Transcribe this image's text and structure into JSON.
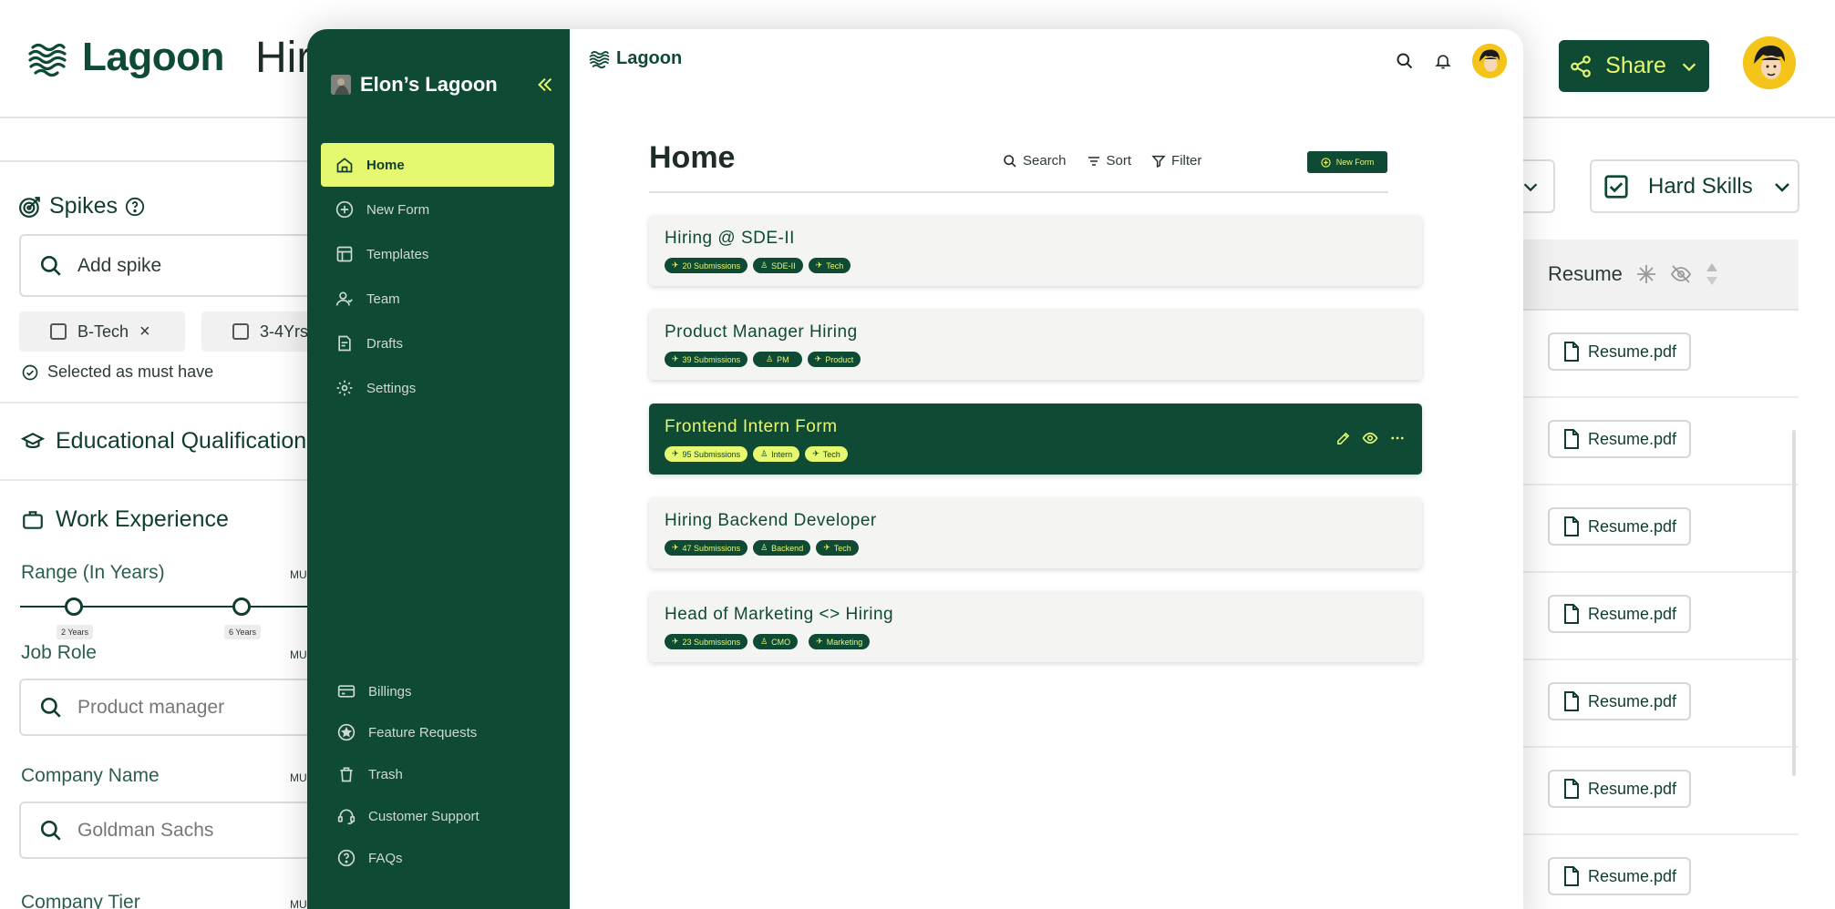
{
  "bg": {
    "logo_text": "Lagoon",
    "page_title": "Hir",
    "share_label": "Share",
    "spikes": {
      "title": "Spikes",
      "search_placeholder": "Add spike",
      "chips": [
        "B-Tech",
        "3-4Yrs"
      ],
      "note": "Selected as must have"
    },
    "sections": {
      "education": "Educational Qualification",
      "work": "Work Experience"
    },
    "range": {
      "label": "Range (In Years)",
      "min_label": "2 Years",
      "max_label": "6 Years",
      "must": "MU"
    },
    "job_role": {
      "label": "Job Role",
      "value": "Product manager",
      "must": "MU"
    },
    "company_name": {
      "label": "Company Name",
      "value": "Goldman Sachs",
      "must": "MU"
    },
    "company_tier": {
      "label": "Company Tier",
      "must": "MU"
    },
    "filter_hard_skills": "Hard Skills",
    "table": {
      "column": "Resume",
      "rows": [
        "Resume.pdf",
        "Resume.pdf",
        "Resume.pdf",
        "Resume.pdf",
        "Resume.pdf",
        "Resume.pdf",
        "Resume.pdf"
      ]
    }
  },
  "overlay": {
    "workspace_name": "Elon’s Lagoon",
    "logo_text": "Lagoon",
    "nav": [
      "Home",
      "New Form",
      "Templates",
      "Team",
      "Drafts",
      "Settings"
    ],
    "nav_bottom": [
      "Billings",
      "Feature Requests",
      "Trash",
      "Customer Support",
      "FAQs"
    ],
    "home_title": "Home",
    "toolbar": {
      "search": "Search",
      "sort": "Sort",
      "filter": "Filter",
      "new_form": "New Form"
    },
    "forms": [
      {
        "title": "Hiring @ SDE-II",
        "tags": [
          "20 Submissions",
          "SDE-II",
          "Tech"
        ]
      },
      {
        "title": "Product Manager Hiring",
        "tags": [
          "39 Submissions",
          "PM",
          "Product"
        ]
      },
      {
        "title": "Frontend Intern Form",
        "tags": [
          "95 Submissions",
          "Intern",
          "Tech"
        ]
      },
      {
        "title": "Hiring Backend Developer",
        "tags": [
          "47 Submissions",
          "Backend",
          "Tech"
        ]
      },
      {
        "title": "Head of Marketing <> Hiring",
        "tags": [
          "23 Submissions",
          "CMO",
          "Marketing"
        ]
      }
    ]
  },
  "colors": {
    "brand_green": "#0f4a35",
    "accent_lime": "#e6f870",
    "avatar_yellow": "#f4c41a"
  }
}
